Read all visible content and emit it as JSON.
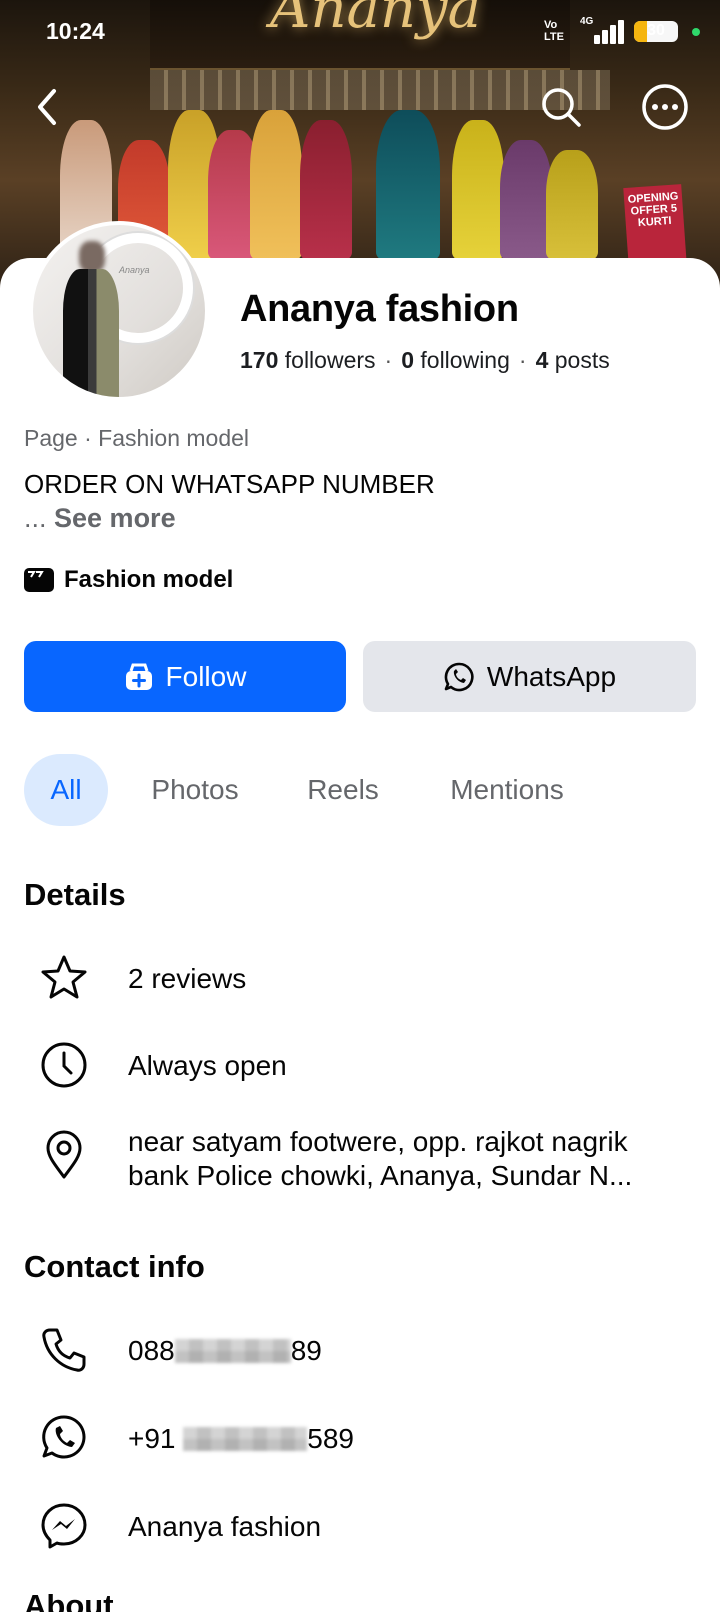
{
  "status_bar": {
    "time": "10:24",
    "volte_line1": "Vo",
    "volte_line2": "LTE",
    "network": "4G",
    "battery": "30"
  },
  "cover": {
    "sign_text": "Ananya",
    "offer_text": "OPENING OFFER 5 KURTI"
  },
  "nav": {
    "back_icon": "chevron-left-icon",
    "search_icon": "search-icon",
    "more_icon": "more-horizontal-icon"
  },
  "profile": {
    "name": "Ananya fashion",
    "followers_count": "170",
    "followers_label": "followers",
    "following_count": "0",
    "following_label": "following",
    "posts_count": "4",
    "posts_label": "posts",
    "page_type": "Page",
    "category": "Fashion model",
    "bio": "ORDER ON WHATSAPP NUMBER",
    "see_more_prefix": "... ",
    "see_more": "See more",
    "category_chip": "Fashion model"
  },
  "actions": {
    "follow_label": "Follow",
    "whatsapp_label": "WhatsApp",
    "follow_color": "#0866ff"
  },
  "tabs": [
    {
      "label": "All",
      "active": true
    },
    {
      "label": "Photos",
      "active": false
    },
    {
      "label": "Reels",
      "active": false
    },
    {
      "label": "Mentions",
      "active": false
    }
  ],
  "details": {
    "title": "Details",
    "items": [
      {
        "icon": "star-icon",
        "text": "2 reviews"
      },
      {
        "icon": "clock-icon",
        "text": "Always open"
      },
      {
        "icon": "location-pin-icon",
        "line1": "near satyam footwere, opp. rajkot nagrik",
        "line2": "bank Police chowki, Ananya, Sundar N..."
      }
    ]
  },
  "contact": {
    "title": "Contact info",
    "items": [
      {
        "icon": "phone-icon",
        "prefix": "088",
        "suffix": "89"
      },
      {
        "icon": "whatsapp-icon",
        "prefix": "+91 ",
        "suffix": "589"
      },
      {
        "icon": "messenger-icon",
        "text": "Ananya fashion"
      }
    ]
  },
  "next_section_title": "About"
}
